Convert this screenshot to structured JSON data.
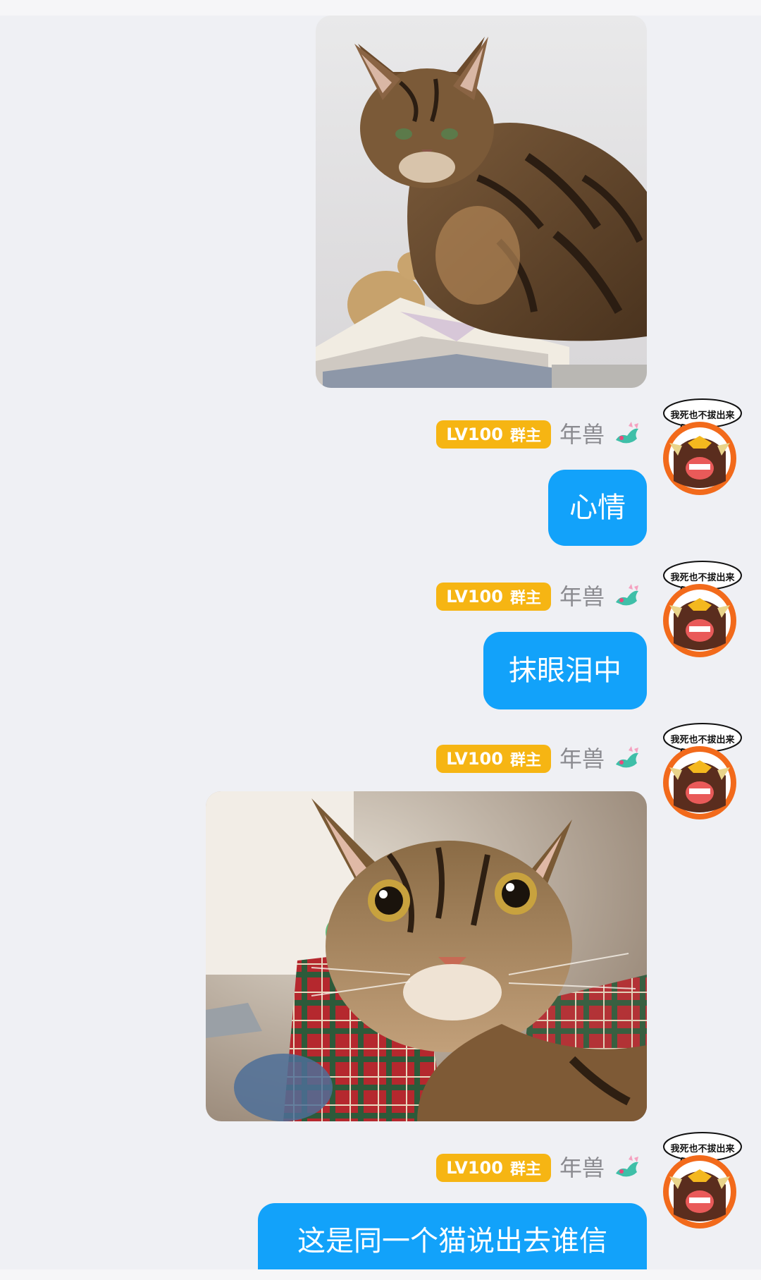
{
  "colors": {
    "background": "#eff0f4",
    "bubble": "#12a2fa",
    "badge": "#f6b513",
    "nickname": "#8a8a8f",
    "avatar_ring": "#f26a1b"
  },
  "messages": [
    {
      "type": "image",
      "sender": {
        "nickname": "年兽",
        "level": "LV100",
        "role": "群主",
        "pendant_icon": "dragon-icon",
        "avatar_caption": "我死也不拔出来"
      },
      "image_description": "cat-sitting-on-papers"
    },
    {
      "type": "text",
      "sender": {
        "nickname": "年兽",
        "level": "LV100",
        "role": "群主",
        "pendant_icon": "dragon-icon",
        "avatar_caption": "我死也不拔出来"
      },
      "text": "心情"
    },
    {
      "type": "text",
      "sender": {
        "nickname": "年兽",
        "level": "LV100",
        "role": "群主",
        "pendant_icon": "dragon-icon",
        "avatar_caption": "我死也不拔出来"
      },
      "text": "抹眼泪中"
    },
    {
      "type": "image",
      "sender": {
        "nickname": "年兽",
        "level": "LV100",
        "role": "群主",
        "pendant_icon": "dragon-icon",
        "avatar_caption": "我死也不拔出来"
      },
      "image_description": "cat-closeup"
    },
    {
      "type": "text",
      "sender": {
        "nickname": "年兽",
        "level": "LV100",
        "role": "群主",
        "pendant_icon": "dragon-icon",
        "avatar_caption": "我死也不拔出来"
      },
      "text": "这是同一个猫说出去谁信"
    }
  ]
}
